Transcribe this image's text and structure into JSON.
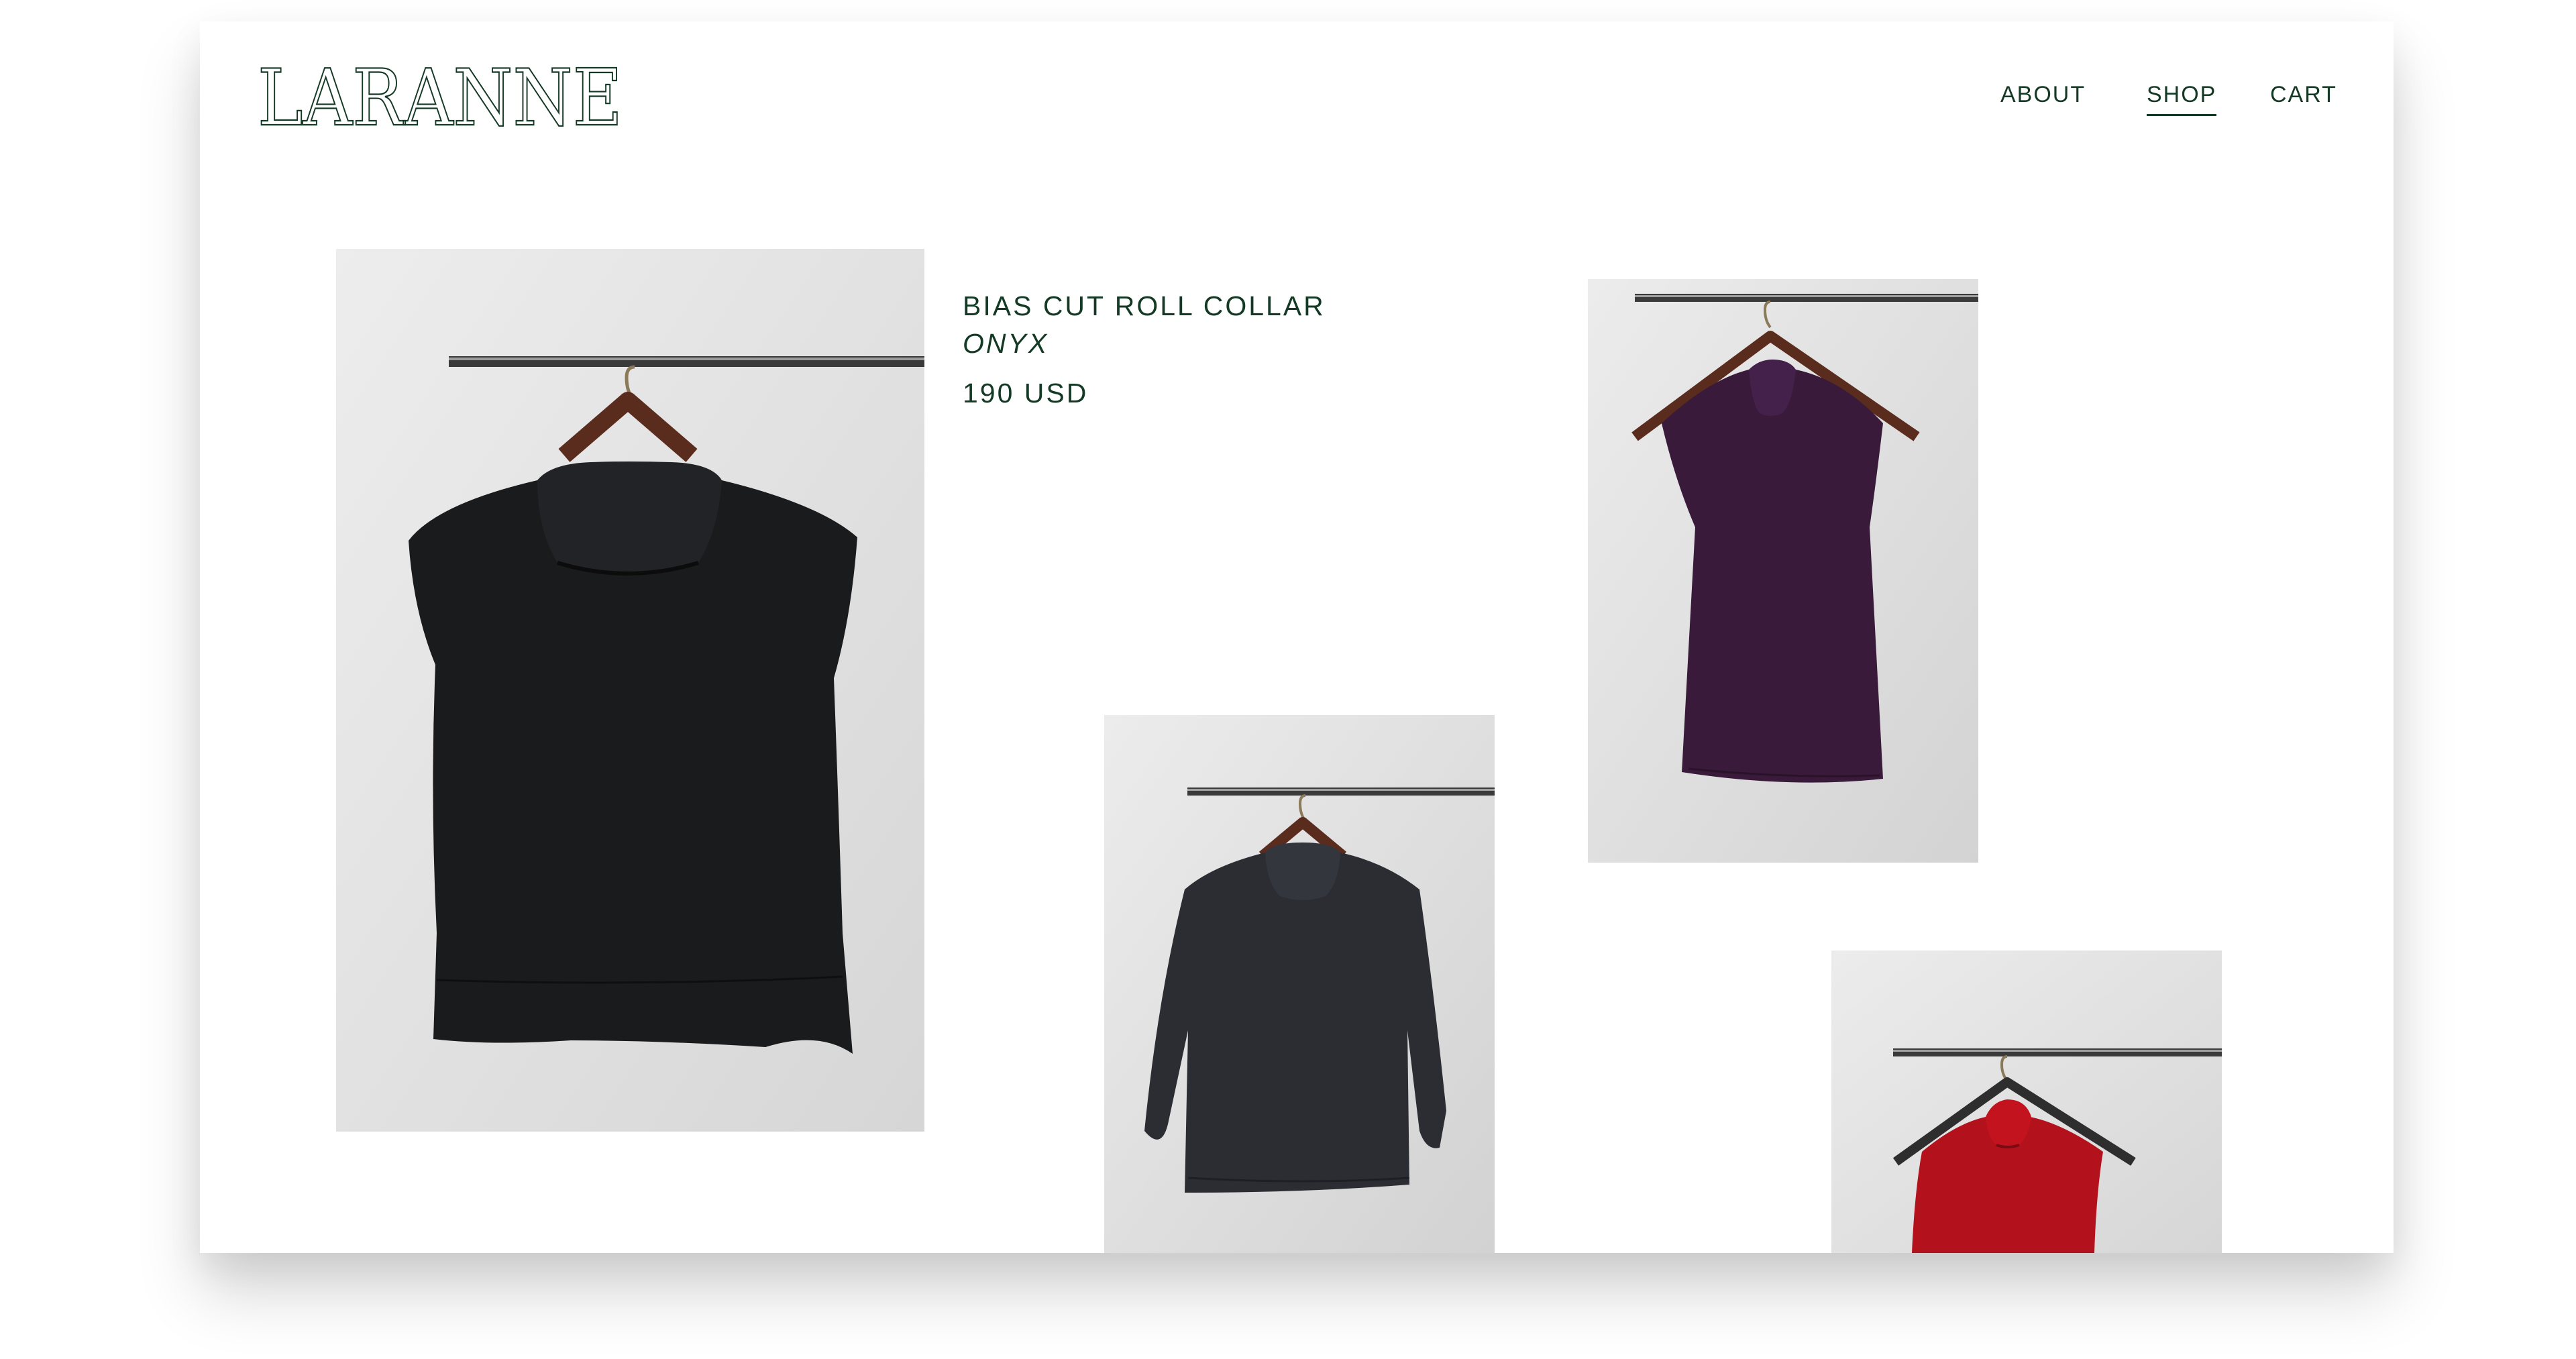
{
  "brand": {
    "name": "LARANNE",
    "color": "#143a26"
  },
  "nav": {
    "about": "ABOUT",
    "shop": "SHOP",
    "cart": "CART",
    "active": "SHOP"
  },
  "product": {
    "name": "BIAS CUT ROLL COLLAR",
    "color": "ONYX",
    "price": "190 USD"
  },
  "gallery": [
    {
      "shirt_color": "#1a1b1d",
      "style": "sleeveless roll collar",
      "icon": "product-photo-onyx"
    },
    {
      "shirt_color": "#2b2d33",
      "style": "three-quarter sleeve roll collar",
      "icon": "product-photo-grey"
    },
    {
      "shirt_color": "#3a1a3a",
      "style": "sleeveless roll collar",
      "icon": "product-photo-plum"
    },
    {
      "shirt_color": "#b3121c",
      "style": "sleeveless roll collar",
      "icon": "product-photo-red"
    }
  ],
  "colors": {
    "accent": "#143a26",
    "background": "#ffffff",
    "photo_backdrop": "#e6e6e6"
  }
}
